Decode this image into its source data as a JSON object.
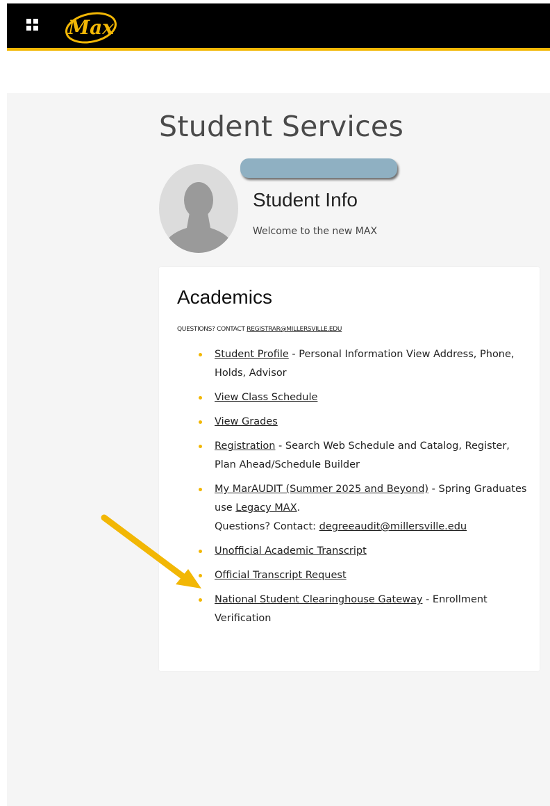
{
  "header": {
    "logo_text": "Max",
    "colors": {
      "bar": "#000000",
      "accent": "#f2b705"
    }
  },
  "page": {
    "title": "Student Services"
  },
  "student": {
    "title": "Student Info",
    "welcome": "Welcome to the new MAX",
    "name_redacted": true
  },
  "academics": {
    "title": "Academics",
    "questions_prefix": "QUESTIONS? CONTACT ",
    "questions_email": "REGISTRAR@MILLERSVILLE.EDU",
    "items": [
      {
        "link": "Student Profile",
        "desc": " - Personal Information View Address, Phone, Holds, Advisor"
      },
      {
        "link": "View Class Schedule"
      },
      {
        "link": "View Grades"
      },
      {
        "link": "Registration",
        "desc": " - Search Web Schedule and Catalog, Register, Plan Ahead/Schedule Builder"
      },
      {
        "link": "My MarAUDIT (Summer 2025 and Beyond)",
        "desc": " - Spring Graduates use ",
        "link2": "Legacy MAX",
        "desc2": ".",
        "line2": "Questions? Contact: ",
        "email": "degreeaudit@millersville.edu"
      },
      {
        "link": "Unofficial Academic Transcript"
      },
      {
        "link": "Official Transcript Request"
      },
      {
        "link": "National Student Clearinghouse Gateway",
        "desc": " - Enrollment Verification"
      }
    ]
  },
  "annotation": {
    "arrow_color": "#f2b705",
    "points_to": "My MarAUDIT (Summer 2025 and Beyond)"
  }
}
